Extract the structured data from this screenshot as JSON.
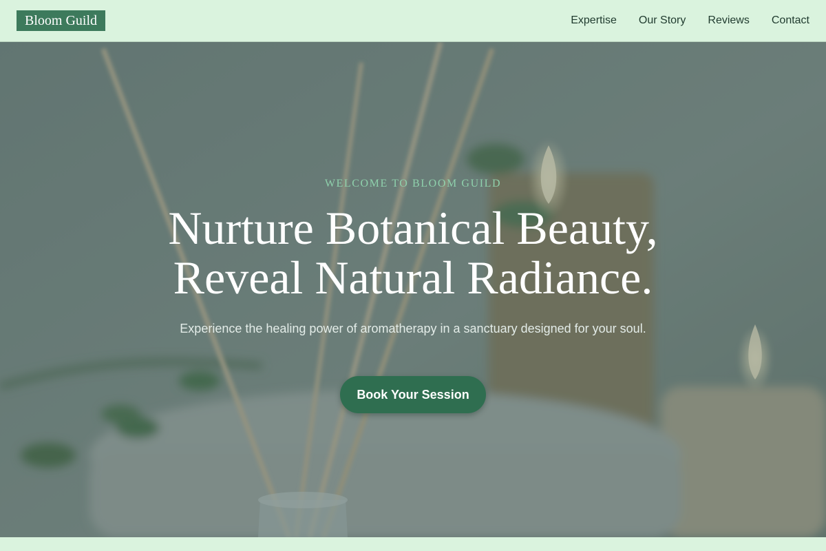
{
  "brand": {
    "name": "Bloom Guild"
  },
  "nav": {
    "links": [
      {
        "label": "Expertise"
      },
      {
        "label": "Our Story"
      },
      {
        "label": "Reviews"
      },
      {
        "label": "Contact"
      }
    ]
  },
  "hero": {
    "eyebrow": "WELCOME TO BLOOM GUILD",
    "headline_lines": [
      "Nurture Botanical Beauty,",
      "Reveal Natural Radiance."
    ],
    "subtext": "Experience the healing power of aromatherapy in a sanctuary designed for your soul.",
    "cta_label": "Book Your Session",
    "background_image": "spa-aromatherapy-image"
  },
  "colors": {
    "nav_background": "#daf3de",
    "logo_background": "#3d7a5c",
    "eyebrow": "#8fd1ac",
    "cta_background": "#2f6e50",
    "text_dark": "#1f3a2e"
  }
}
